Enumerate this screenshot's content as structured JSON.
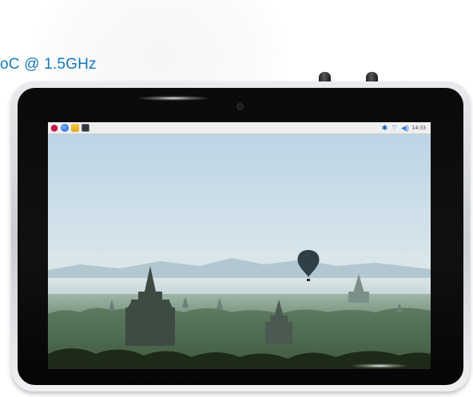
{
  "headline": "oC @ 1.5GHz",
  "device": {
    "taskbar": {
      "launchers": [
        {
          "icon": "raspberry-menu-icon"
        },
        {
          "icon": "web-browser-icon"
        },
        {
          "icon": "file-manager-icon"
        },
        {
          "icon": "terminal-icon"
        }
      ],
      "status": {
        "bluetooth_glyph": "✱",
        "wifi_glyph": "⌔",
        "volume_glyph": "◀)",
        "clock": "14:33"
      }
    },
    "wallpaper": "misty temple plains with hot-air balloon"
  },
  "colors": {
    "headline": "#1578b8",
    "bezel": "#0a0a0a",
    "frame": "#d6d9dd",
    "taskbar": "#eeeeee"
  }
}
